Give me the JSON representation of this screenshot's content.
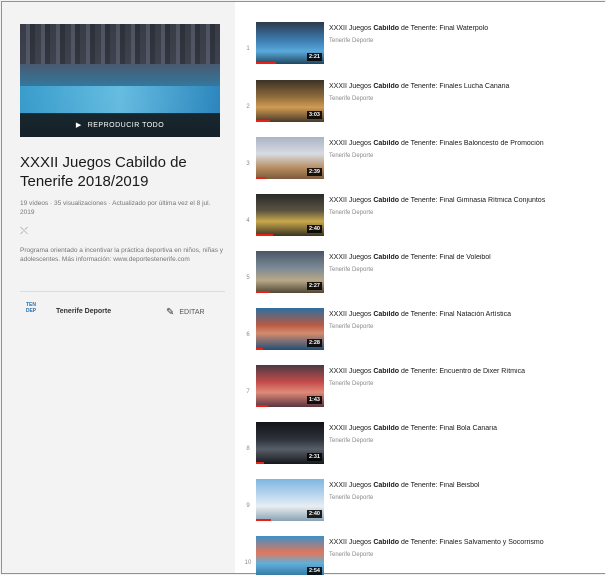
{
  "sidebar": {
    "play_all_label": "REPRODUCIR TODO",
    "title": "XXXII Juegos Cabildo de Tenerife 2018/2019",
    "meta": "19 vídeos · 35 visualizaciones · Actualizado por última vez el 8 jul. 2019",
    "description": "Programa orientado a incentivar la práctica deportiva en niños, niñas y adolescentes. Más información: www.deportestenerife.com",
    "owner_avatar": "TEN DEP",
    "owner_name": "Tenerife Deporte",
    "edit_label": "EDITAR"
  },
  "videos": [
    {
      "index": "1",
      "prefix": "XXXII Juegos ",
      "bold": "Cabildo",
      "rest": " de Tenerife: Final Waterpolo",
      "channel": "Tenerife Deporte",
      "duration": "2:21"
    },
    {
      "index": "2",
      "prefix": "XXXII Juegos ",
      "bold": "Cabildo",
      "rest": " de Tenerife: Finales Lucha Canaria",
      "channel": "Tenerife Deporte",
      "duration": "3:03"
    },
    {
      "index": "3",
      "prefix": "XXXII Juegos ",
      "bold": "Cabildo",
      "rest": " de Tenerife: Finales Baloncesto de Promoción",
      "channel": "Tenerife Deporte",
      "duration": "2:39"
    },
    {
      "index": "4",
      "prefix": "XXXII Juegos ",
      "bold": "Cabildo",
      "rest": " de Tenerife: Final Gimnasia Rítmica Conjuntos",
      "channel": "Tenerife Deporte",
      "duration": "2:40"
    },
    {
      "index": "5",
      "prefix": "XXXII Juegos ",
      "bold": "Cabildo",
      "rest": " de Tenerife: Final de Voleibol",
      "channel": "Tenerife Deporte",
      "duration": "2:27"
    },
    {
      "index": "6",
      "prefix": "XXXII Juegos ",
      "bold": "Cabildo",
      "rest": " de Tenerife: Final Natación Artística",
      "channel": "Tenerife Deporte",
      "duration": "2:28"
    },
    {
      "index": "7",
      "prefix": "XXXII Juegos ",
      "bold": "Cabildo",
      "rest": " de Tenerife: Encuentro de Dixer Rítmica",
      "channel": "Tenerife Deporte",
      "duration": "1:43"
    },
    {
      "index": "8",
      "prefix": "XXXII Juegos ",
      "bold": "Cabildo",
      "rest": " de Tenerife: Final Bola Canaria",
      "channel": "Tenerife Deporte",
      "duration": "2:31"
    },
    {
      "index": "9",
      "prefix": "XXXII Juegos ",
      "bold": "Cabildo",
      "rest": " de Tenerife: Final Beisbol",
      "channel": "Tenerife Deporte",
      "duration": "2:40"
    },
    {
      "index": "10",
      "prefix": "XXXII Juegos ",
      "bold": "Cabildo",
      "rest": " de Tenerife: Finales Salvamento y Socorrismo",
      "channel": "Tenerife Deporte",
      "duration": "2:54"
    }
  ]
}
